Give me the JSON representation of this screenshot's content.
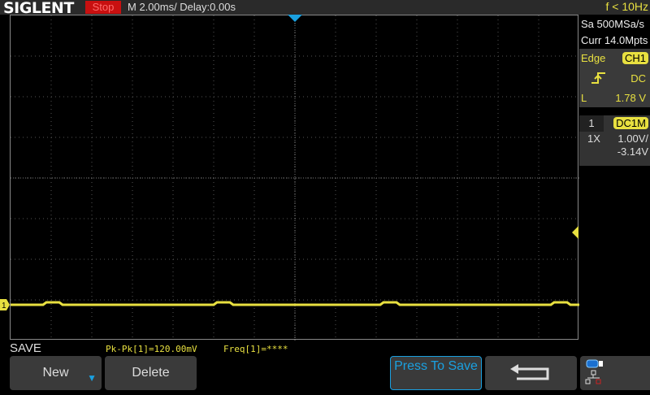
{
  "header": {
    "brand": "SIGLENT",
    "run_state": "Stop",
    "timebase": "M 2.00ms/ Delay:0.00s",
    "frequency": "f < 10Hz"
  },
  "acquisition": {
    "sample_rate": "Sa 500MSa/s",
    "memory": "Curr 14.0Mpts"
  },
  "trigger": {
    "type": "Edge",
    "source": "CH1",
    "slope_icon": "rising-edge-icon",
    "coupling": "DC",
    "level_label": "L",
    "level": "1.78 V"
  },
  "channel": {
    "number": "1",
    "coupling": "DC1M",
    "probe": "1X",
    "scale": "1.00V/",
    "offset": "-3.14V",
    "color": "#e8e040",
    "marker": "1"
  },
  "menu": {
    "title": "SAVE",
    "buttons": [
      {
        "label": "New"
      },
      {
        "label": "Delete"
      },
      {
        "label": "Press To Save"
      },
      {
        "label": "back-arrow-icon"
      }
    ]
  },
  "measurements": {
    "pkpk": "Pk-Pk[1]=120.00mV",
    "freq": "Freq[1]=****"
  },
  "status_icons": [
    "usb-icon",
    "network-disconnected-icon"
  ]
}
